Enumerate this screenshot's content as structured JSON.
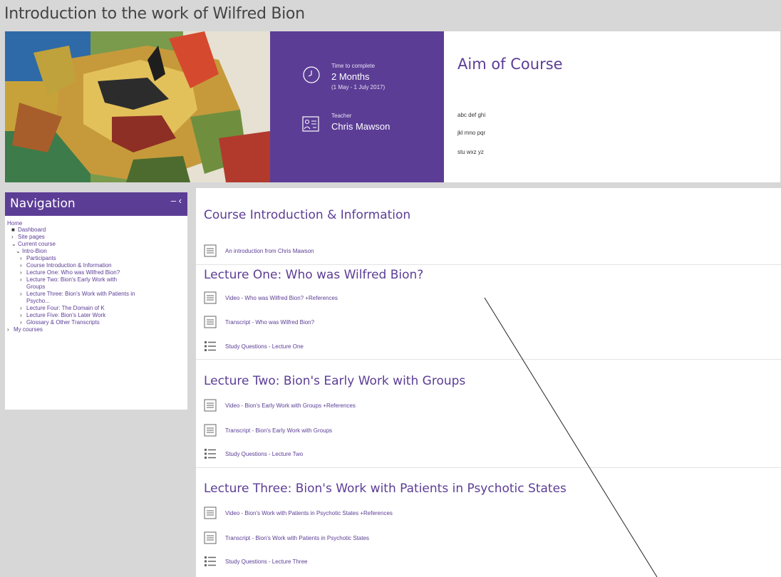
{
  "course": {
    "title": "Introduction to the work of Wilfred Bion"
  },
  "hero": {
    "time_label": "Time to complete",
    "time_value": "2 Months",
    "time_dates": "(1 May - 1 July 2017)",
    "teacher_label": "Teacher",
    "teacher_name": "Chris Mawson",
    "aim_title": "Aim of Course",
    "aim_lines": [
      "abc def ghi",
      "jkl mno pqr",
      "stu wxz yz"
    ],
    "colors": {
      "purple": "#5c3d96"
    }
  },
  "navigation": {
    "title": "Navigation",
    "control": "– ‹",
    "items": [
      {
        "label": "Home",
        "marker": ""
      },
      {
        "label": "Dashboard",
        "marker": "■"
      },
      {
        "label": "Site pages",
        "marker": "›"
      },
      {
        "label": "Current course",
        "marker": "⌄"
      },
      {
        "label": "Intro-Bion",
        "marker": "⌄"
      },
      {
        "label": "Participants",
        "marker": "›"
      },
      {
        "label": "Course Introduction & Information",
        "marker": "›"
      },
      {
        "label": "Lecture One: Who was Wilfred Bion?",
        "marker": "›"
      },
      {
        "label": "Lecture Two: Bion's Early Work with",
        "marker": "›"
      },
      {
        "label": "Groups",
        "marker": ""
      },
      {
        "label": "Lecture Three: Bion's Work with Patients in",
        "marker": "›"
      },
      {
        "label": "Psycho...",
        "marker": ""
      },
      {
        "label": "Lecture Four: The Domain of K",
        "marker": "›"
      },
      {
        "label": "Lecture Five: Bion's Later Work",
        "marker": "›"
      },
      {
        "label": "Glossary & Other Transcripts",
        "marker": "›"
      },
      {
        "label": "My courses",
        "marker": "›"
      }
    ]
  },
  "sections": [
    {
      "title": "Course Introduction & Information",
      "activities": [
        {
          "label": "An introduction from Chris Mawson",
          "icon": "page-icon"
        }
      ]
    },
    {
      "title": "Lecture One: Who was Wilfred Bion?",
      "activities": [
        {
          "label": "Video - Who was Wilfred Bion? +References",
          "icon": "page-icon"
        },
        {
          "label": "Transcript - Who was Wilfred Bion?",
          "icon": "page-icon"
        },
        {
          "label": "Study Questions - Lecture One",
          "icon": "list-icon"
        }
      ]
    },
    {
      "title": "Lecture Two: Bion's Early Work with Groups",
      "activities": [
        {
          "label": "Video - Bion's Early Work with Groups +References",
          "icon": "page-icon"
        },
        {
          "label": "Transcript - Bion's Early Work with Groups",
          "icon": "page-icon"
        },
        {
          "label": "Study Questions - Lecture Two",
          "icon": "list-icon"
        }
      ]
    },
    {
      "title": "Lecture Three: Bion's Work with Patients in Psychotic States",
      "activities": [
        {
          "label": "Video - Bion's Work with Patients in Psychotic States +References",
          "icon": "page-icon"
        },
        {
          "label": "Transcript - Bion's Work with Patients in Psychotic States",
          "icon": "page-icon"
        },
        {
          "label": "Study Questions - Lecture Three",
          "icon": "list-icon"
        }
      ]
    }
  ]
}
